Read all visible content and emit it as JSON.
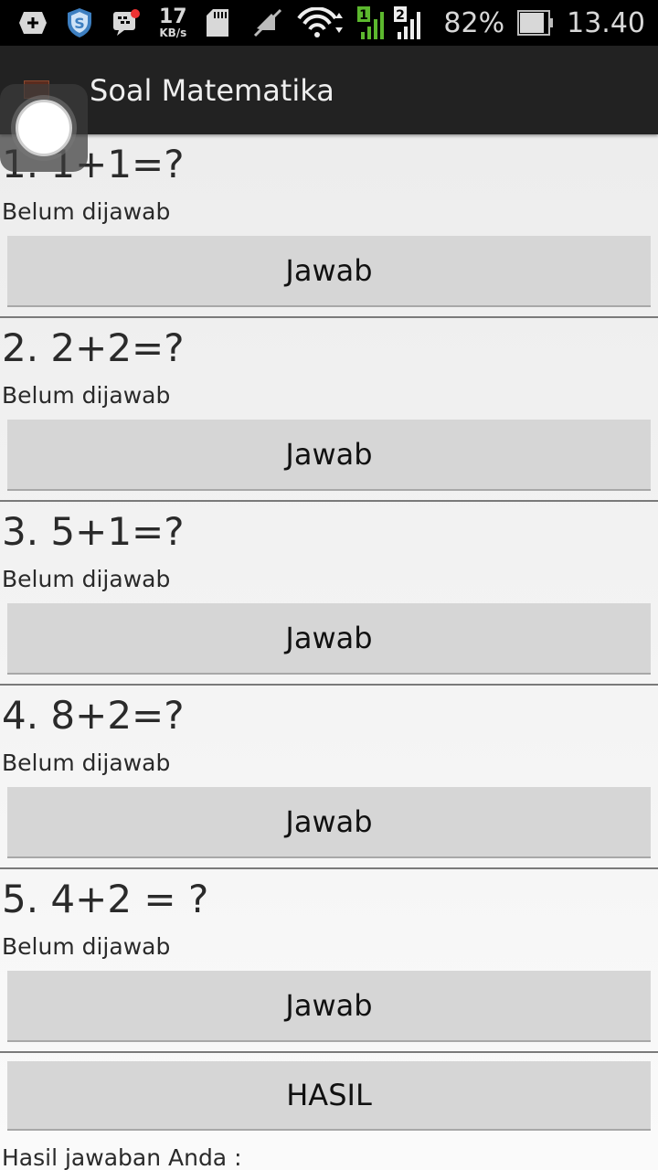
{
  "status_bar": {
    "net_speed_value": "17",
    "net_speed_unit": "KB/s",
    "sim1": "1",
    "sim2": "2",
    "battery_percent": "82%",
    "time": "13.40",
    "icons": [
      "plus-icon",
      "shield-icon",
      "bbm-icon",
      "sd-card-icon",
      "mute-icon",
      "wifi-icon",
      "signal-icon",
      "battery-icon"
    ]
  },
  "app_bar": {
    "title": "Soal Matematika"
  },
  "questions": [
    {
      "text": "1. 1+1=?",
      "status": "Belum dijawab",
      "button": "Jawab"
    },
    {
      "text": "2. 2+2=?",
      "status": "Belum dijawab",
      "button": "Jawab"
    },
    {
      "text": "3. 5+1=?",
      "status": "Belum dijawab",
      "button": "Jawab"
    },
    {
      "text": "4. 8+2=?",
      "status": "Belum dijawab",
      "button": "Jawab"
    },
    {
      "text": "5. 4+2 = ?",
      "status": "Belum dijawab",
      "button": "Jawab"
    }
  ],
  "result": {
    "button": "HASIL",
    "label": "Hasil jawaban Anda :"
  }
}
